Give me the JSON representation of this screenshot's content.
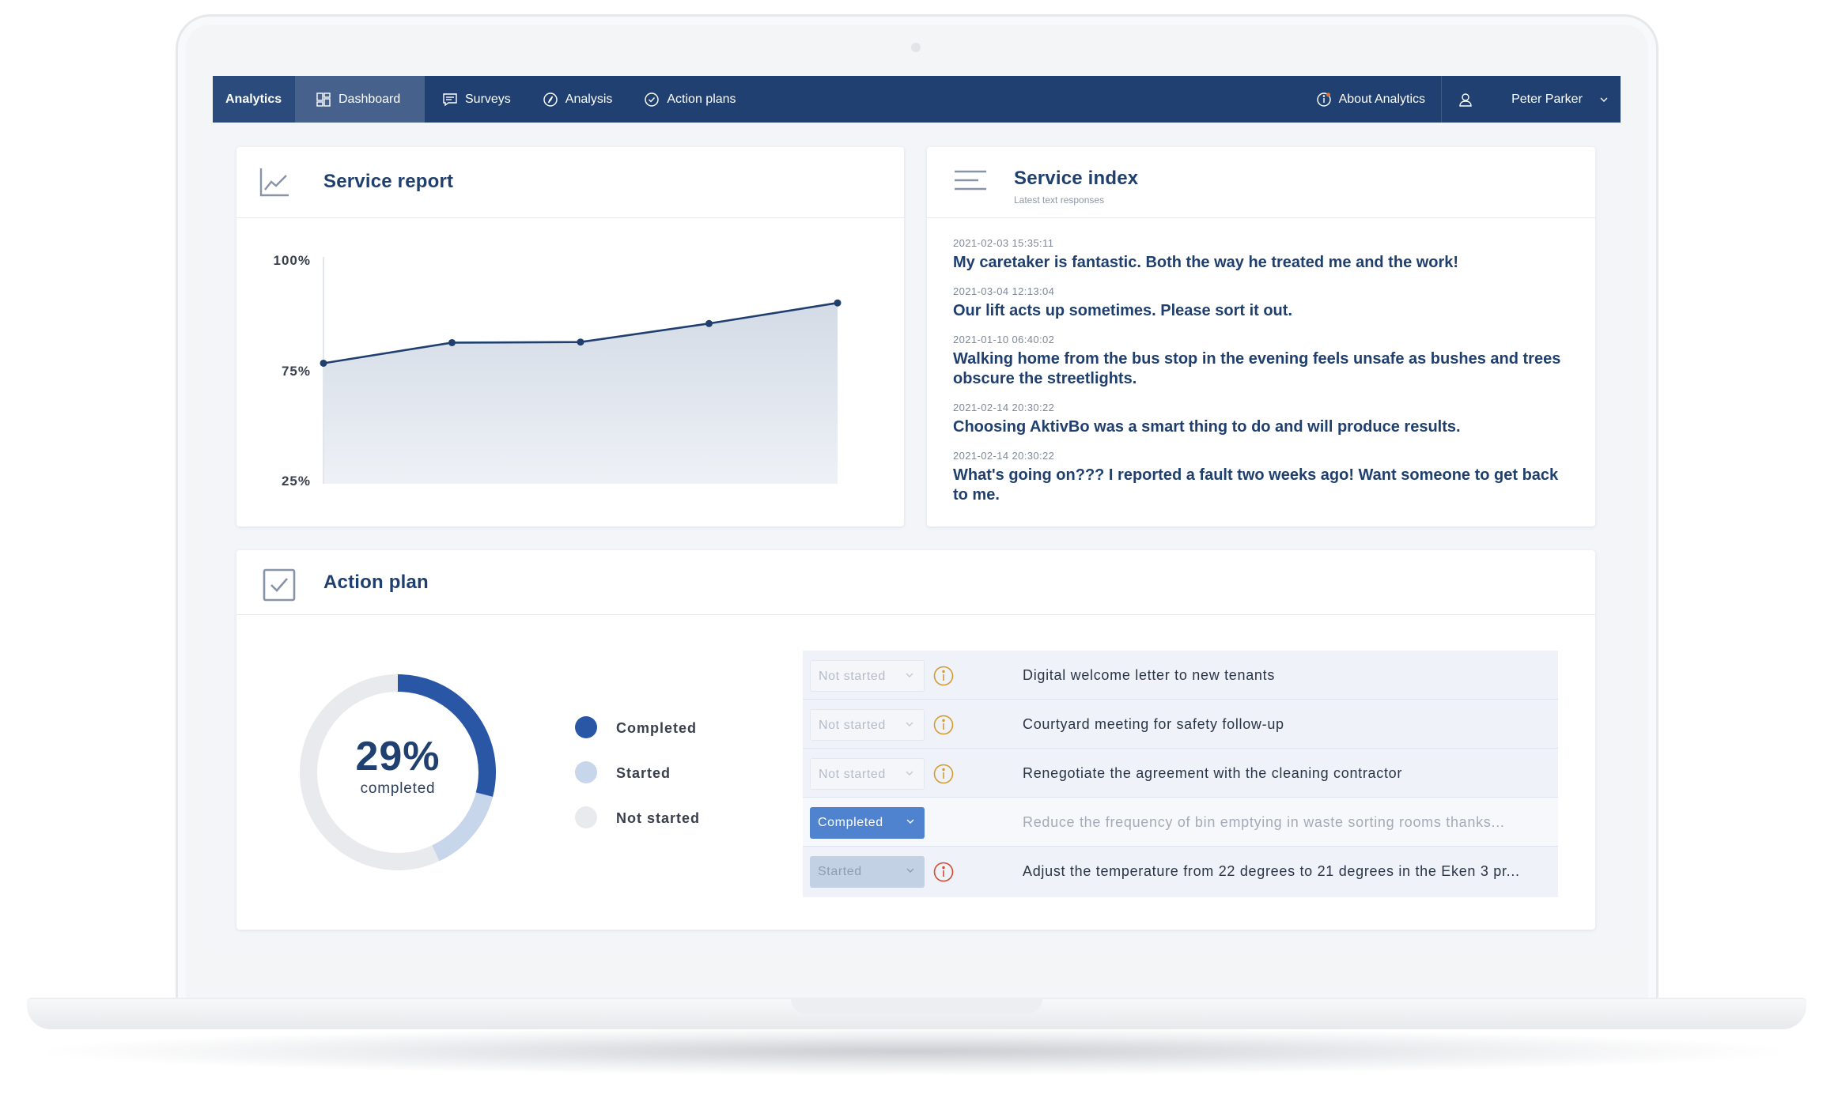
{
  "nav": {
    "brand": "Analytics",
    "items": [
      {
        "label": "Dashboard",
        "icon": "dashboard-grid-icon"
      },
      {
        "label": "Surveys",
        "icon": "chat-bubble-icon"
      },
      {
        "label": "Analysis",
        "icon": "compass-icon"
      },
      {
        "label": "Action plans",
        "icon": "check-circle-icon"
      }
    ],
    "about": "About Analytics",
    "user": "Peter Parker"
  },
  "service_report": {
    "title": "Service report",
    "icon": "line-chart-icon"
  },
  "chart_data": {
    "type": "area",
    "title": "Service report",
    "y_ticks": [
      "100%",
      "75%",
      "25%"
    ],
    "x": [
      1,
      2,
      3,
      4,
      5
    ],
    "values": [
      66,
      73,
      73.2,
      79.5,
      86.5
    ],
    "ylim": [
      25,
      100
    ],
    "grid": false,
    "colors": {
      "line": "#1f3f6e",
      "fill_top": "#d3dbe6",
      "fill_bottom": "#eef1f6"
    }
  },
  "service_index": {
    "title": "Service index",
    "subtitle": "Latest text responses",
    "icon": "text-lines-icon",
    "responses": [
      {
        "time": "2021-02-03 15:35:11",
        "text": "My caretaker is fantastic. Both the way he treated me and the work!"
      },
      {
        "time": "2021-03-04 12:13:04",
        "text": "Our lift acts up sometimes. Please sort it out."
      },
      {
        "time": "2021-01-10 06:40:02",
        "text": "Walking home from the bus stop in the evening feels unsafe as bushes and trees obscure the streetlights."
      },
      {
        "time": "2021-02-14 20:30:22",
        "text": "Choosing AktivBo was a smart thing to do and will produce results."
      },
      {
        "time": "2021-02-14 20:30:22",
        "text": "What's going on??? I reported a fault two weeks ago! Want someone to get back to me."
      }
    ]
  },
  "action_plan": {
    "title": "Action plan",
    "icon": "checkbox-icon",
    "donut": {
      "percent_label": "29%",
      "caption": "completed",
      "completed_fraction": 0.29,
      "started_fraction": 0.14
    },
    "legend": [
      {
        "label": "Completed",
        "color": "#2a56a6"
      },
      {
        "label": "Started",
        "color": "#c7d6ea"
      },
      {
        "label": "Not started",
        "color": "#e8eaed"
      }
    ],
    "rows": [
      {
        "status": "Not started",
        "kind": "ns",
        "info": "orange",
        "text": "Digital welcome letter to new tenants"
      },
      {
        "status": "Not started",
        "kind": "ns",
        "info": "orange",
        "text": "Courtyard meeting for safety follow-up"
      },
      {
        "status": "Not started",
        "kind": "ns",
        "info": "orange",
        "text": "Renegotiate the agreement with the cleaning contractor"
      },
      {
        "status": "Completed",
        "kind": "done",
        "info": "none",
        "text": "Reduce the frequency of bin emptying in waste sorting rooms thanks..."
      },
      {
        "status": "Started",
        "kind": "started",
        "info": "red",
        "text": "Adjust the temperature from 22 degrees to 21 degrees in the Eken 3 pr..."
      }
    ]
  }
}
